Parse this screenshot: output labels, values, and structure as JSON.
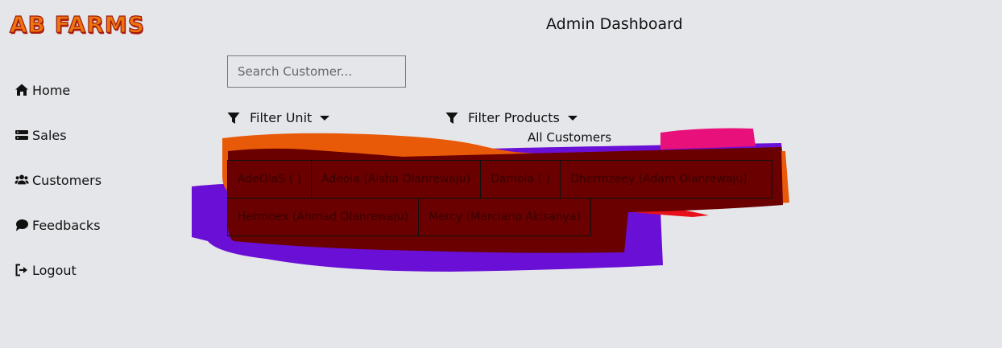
{
  "brand": {
    "logo_text": "AB FARMS"
  },
  "sidebar": {
    "items": [
      {
        "label": "Home",
        "icon": "home-icon"
      },
      {
        "label": "Sales",
        "icon": "server-icon"
      },
      {
        "label": "Customers",
        "icon": "users-icon"
      },
      {
        "label": "Feedbacks",
        "icon": "comment-icon"
      },
      {
        "label": "Logout",
        "icon": "logout-icon"
      }
    ]
  },
  "header": {
    "title": "Admin Dashboard"
  },
  "search": {
    "placeholder": "Search Customer..."
  },
  "filters": {
    "unit": {
      "label": "Filter Unit",
      "icon": "filter-icon"
    },
    "products": {
      "label": "Filter Products",
      "icon": "filter-icon"
    }
  },
  "customers": {
    "heading": "All Customers",
    "rows": [
      [
        "AdeOlaS ( )",
        "Adeola (Aisha Olanrewaju)",
        "Damola ( )",
        "Dhermzeey (Adam Olanrewaju)"
      ],
      [
        "Hermoex (Ahmad Olanrewaju)",
        "Mercy (Merciano Akisanya)"
      ]
    ]
  },
  "colors": {
    "background": "#e5e6ea",
    "logo_fill": "#f0740e",
    "logo_stroke": "#9b1c0c",
    "scribble_dark_red": "#6a0000",
    "scribble_purple": "#6a0fd6",
    "scribble_orange": "#e85a08",
    "scribble_pink": "#e8107a"
  }
}
